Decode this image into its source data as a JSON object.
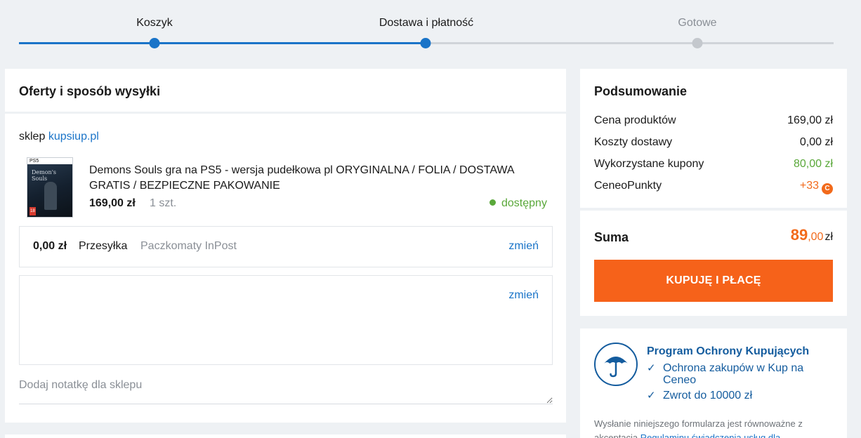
{
  "progress": {
    "steps": [
      {
        "label": "Koszyk"
      },
      {
        "label": "Dostawa i płatność"
      },
      {
        "label": "Gotowe"
      }
    ]
  },
  "offers": {
    "header": "Oferty i sposób wysyłki",
    "shop_prefix": "sklep",
    "shop_name": "kupsiup.pl",
    "product": {
      "name": "Demons Souls gra na PS5 - wersja pudełkowa pl ORYGINALNA / FOLIA / DOSTAWA GRATIS / BEZPIECZNE PAKOWANIE",
      "price": "169,00 zł",
      "quantity": "1 szt.",
      "availability": "dostępny",
      "thumb_platform": "PS5",
      "thumb_title": "Demon's Souls",
      "thumb_age": "18"
    },
    "shipping": {
      "cost": "0,00 zł",
      "type": "Przesyłka",
      "method": "Paczkomaty InPost",
      "change_label": "zmień"
    },
    "address": {
      "change_label": "zmień"
    },
    "note_placeholder": "Dodaj notatkę dla sklepu"
  },
  "summary": {
    "title": "Podsumowanie",
    "rows": [
      {
        "label": "Cena produktów",
        "value": "169,00 zł"
      },
      {
        "label": "Koszty dostawy",
        "value": "0,00 zł"
      },
      {
        "label": "Wykorzystane kupony",
        "value": "80,00 zł"
      },
      {
        "label": "CeneoPunkty",
        "value": "+33"
      }
    ],
    "coin_glyph": "C",
    "total_label": "Suma",
    "total_int": "89",
    "total_dec": ",00",
    "total_currency": "zł",
    "buy_button": "KUPUJĘ I PŁACĘ"
  },
  "protection": {
    "title": "Program Ochrony Kupujących",
    "items": [
      {
        "check": "✓",
        "text": "Ochrona zakupów w Kup na Ceneo"
      },
      {
        "check": "✓",
        "text": "Zwrot do 10000 zł"
      }
    ],
    "legal_text": "Wysłanie niniejszego formularza jest równoważne z akceptacją",
    "legal_link": "Regulaminu świadczenia usług dla"
  },
  "colors": {
    "accent": "#1a74c8",
    "orange": "#f26a1b",
    "green": "#5aa83a"
  }
}
